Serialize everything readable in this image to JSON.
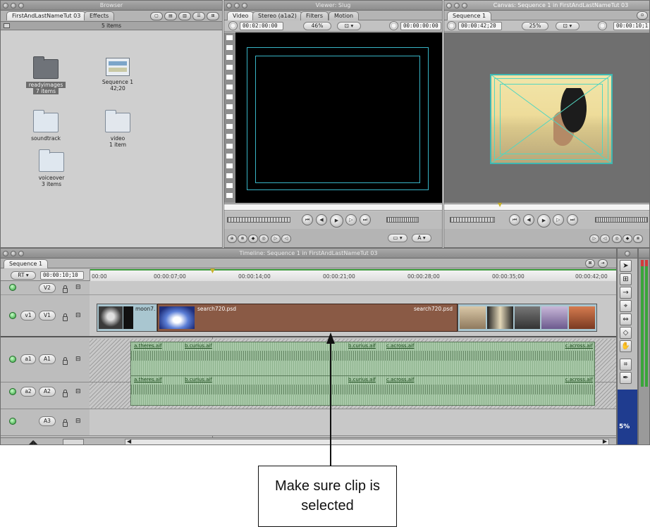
{
  "browser": {
    "title": "Browser",
    "tabs": [
      "FirstAndLastNameTut 03",
      "Effects"
    ],
    "item_count": "5 items",
    "bins": [
      {
        "name": "readyimages",
        "detail": "7 items"
      },
      {
        "name": "Sequence 1",
        "detail": "42;20"
      },
      {
        "name": "soundtrack",
        "detail": ""
      },
      {
        "name": "video",
        "detail": "1 item"
      },
      {
        "name": "voiceover",
        "detail": "3 items"
      }
    ]
  },
  "viewer": {
    "title": "Viewer: Slug",
    "tabs": [
      "Video",
      "Stereo (a1a2)",
      "Filters",
      "Motion"
    ],
    "duration": "00:02:00:00",
    "zoom": "46%",
    "current_time": "00:00:00:00"
  },
  "canvas": {
    "title": "Canvas: Sequence 1 in FirstAndLastNameTut 03",
    "tabs": [
      "Sequence 1"
    ],
    "duration": "00:00:42;20",
    "zoom": "25%",
    "current_time": "00:00:10;1"
  },
  "timeline": {
    "title": "Timeline: Sequence 1 in FirstAndLastNameTut 03",
    "tab": "Sequence 1",
    "rt_label": "RT",
    "current_time": "00:00:10;10",
    "ruler": [
      "00:00",
      "00:00:07;00",
      "00:00:14;00",
      "00:00:21;00",
      "00:00:28;00",
      "00:00:35;00",
      "00:00:42;00"
    ],
    "tracks": {
      "v2": {
        "dest": "",
        "src": "V2"
      },
      "v1": {
        "dest": "v1",
        "src": "V1"
      },
      "a1": {
        "dest": "a1",
        "src": "A1"
      },
      "a2": {
        "dest": "a2",
        "src": "A2"
      },
      "a3": {
        "dest": "",
        "src": "A3"
      }
    },
    "video_clips": [
      "moon7.",
      "search720.psd",
      "search720.psd"
    ],
    "audio_clips_a1": [
      "a.theres.aif",
      "b.curius.aif",
      "b.curius.aif",
      "c.across.aif",
      "c.across.aif"
    ],
    "audio_clips_a2": [
      "a.theres.aif",
      "b.curius.aif",
      "b.curius.aif",
      "c.across.aif",
      "c.across.aif"
    ]
  },
  "tools": {
    "zoom_readout": "5%"
  },
  "annotation": {
    "text": "Make sure clip is selected"
  }
}
